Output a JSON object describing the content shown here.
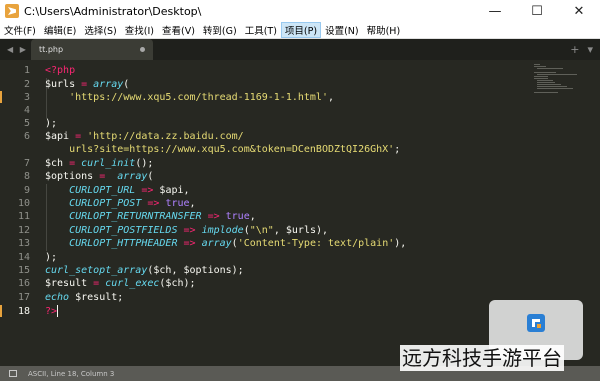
{
  "window": {
    "title": "C:\\Users\\Administrator\\Desktop\\",
    "controls": [
      "—",
      "☐",
      "✕"
    ]
  },
  "menu": [
    "文件(F)",
    "编辑(E)",
    "选择(S)",
    "查找(I)",
    "查看(V)",
    "转到(G)",
    "工具(T)",
    "项目(P)",
    "设置(N)",
    "帮助(H)"
  ],
  "tabs": {
    "nav": "◀ ▶",
    "active": "tt.php",
    "add": "+",
    "dropdown": "▾"
  },
  "editor": {
    "line_numbers": [
      "1",
      "2",
      "3",
      "4",
      "5",
      "6",
      "7",
      "8",
      "9",
      "10",
      "11",
      "12",
      "13",
      "14",
      "15",
      "16",
      "17",
      "18"
    ],
    "current_line": "18"
  },
  "code": {
    "l1_open": "<?php",
    "l2_var": "$urls",
    "l2_eq": " = ",
    "l2_fn": "array",
    "l2_paren": "(",
    "l3_str": "'https://www.xqu5.com/thread-1169-1-1.html'",
    "l3_comma": ",",
    "l5_close": ");",
    "l6_var": "$api",
    "l6_eq": " = ",
    "l6_str": "'http://data.zz.baidu.com/",
    "l7_str": "urls?site=https://www.xqu5.com&token=DCenBODZtQI26GhX'",
    "l7_semi": ";",
    "l8_var": "$ch",
    "l8_eq": " = ",
    "l8_fn": "curl_init",
    "l8_tail": "();",
    "l9_var": "$options",
    "l9_eq": " =  ",
    "l9_fn": "array",
    "l9_paren": "(",
    "l10_const": "CURLOPT_URL",
    "l10_arrow": " => ",
    "l10_val": "$api",
    "l10_comma": ",",
    "l11_const": "CURLOPT_POST",
    "l11_arrow": " => ",
    "l11_val": "true",
    "l11_comma": ",",
    "l12_const": "CURLOPT_RETURNTRANSFER",
    "l12_arrow": " => ",
    "l12_val": "true",
    "l12_comma": ",",
    "l13_const": "CURLOPT_POSTFIELDS",
    "l13_arrow": " => ",
    "l13_fn": "implode",
    "l13_p1": "(",
    "l13_str": "\"\\n\"",
    "l13_p2": ", $urls),",
    "l14_const": "CURLOPT_HTTPHEADER",
    "l14_arrow": " => ",
    "l14_fn": "array",
    "l14_p1": "(",
    "l14_str": "'Content-Type: text/plain'",
    "l14_p2": "),",
    "l15_close": ");",
    "l16_fn": "curl_setopt_array",
    "l16_tail": "($ch, $options);",
    "l17_var": "$result",
    "l17_eq": " = ",
    "l17_fn": "curl_exec",
    "l17_tail": "($ch);",
    "l18_kw": "echo",
    "l18_tail": " $result;",
    "l19_close": "?>"
  },
  "status": {
    "text": "ASCII, Line 18, Column 3"
  },
  "watermark": {
    "site_text": "远方科技手游平台"
  },
  "colors": {
    "background": "#272822",
    "keyword": "#f92672",
    "string": "#e6db74",
    "function": "#66d9ef",
    "constant": "#ae81ff",
    "text": "#f8f8f2"
  }
}
